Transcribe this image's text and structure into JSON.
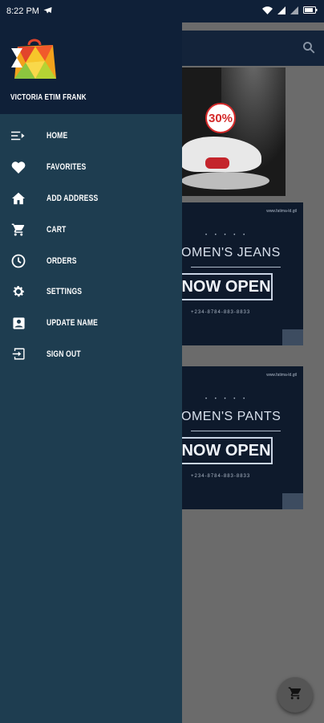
{
  "status_bar": {
    "time": "8:22 PM",
    "battery": ""
  },
  "drawer": {
    "username": "VICTORIA ETIM FRANK",
    "items": [
      {
        "label": "HOME",
        "icon": "home-menu-icon"
      },
      {
        "label": "FAVORITES",
        "icon": "heart-icon"
      },
      {
        "label": "ADD ADDRESS",
        "icon": "house-icon"
      },
      {
        "label": "CART",
        "icon": "cart-icon"
      },
      {
        "label": "ORDERS",
        "icon": "clock-icon"
      },
      {
        "label": "SETTINGS",
        "icon": "gear-icon"
      },
      {
        "label": "UPDATE NAME",
        "icon": "account-box-icon"
      },
      {
        "label": "SIGN OUT",
        "icon": "exit-icon"
      }
    ]
  },
  "content": {
    "promo_badge": "30%",
    "banners": [
      {
        "title": "OMEN'S JEANS",
        "cta": "NOW OPEN",
        "phone": "+234-8784-883-8833",
        "url": "www.fatima-ld.gtl"
      },
      {
        "title": "OMEN'S PANTS",
        "cta": "NOW OPEN",
        "phone": "+234-8784-883-8833",
        "url": "www.fatima-ld.gtl"
      }
    ]
  },
  "colors": {
    "drawer_bg": "#1e3d50",
    "header_bg": "#0f2038",
    "scrim": "#6b6b6b"
  }
}
